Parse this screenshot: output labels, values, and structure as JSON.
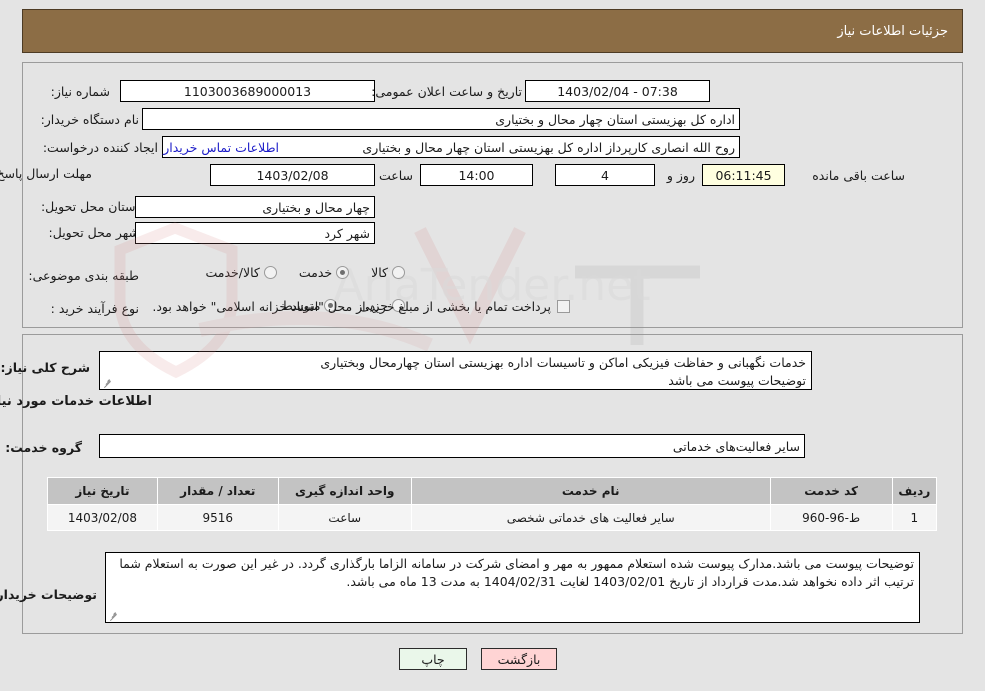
{
  "header": {
    "title": "جزئیات اطلاعات نیاز"
  },
  "top_form": {
    "need_number_label": "شماره نیاز:",
    "need_number_value": "1103003689000013",
    "public_announce_label": "تاریخ و ساعت اعلان عمومی:",
    "public_announce_value": "07:38 - 1403/02/04",
    "buyer_org_label": "نام دستگاه خریدار:",
    "buyer_org_value": "اداره کل بهزیستی استان چهار محال و بختیاری",
    "requester_label": "ایجاد کننده درخواست:",
    "requester_value": "روح الله انصاری کارپرداز اداره کل بهزیستی استان چهار محال و بختیاری",
    "buyer_contact_link": "اطلاعات تماس خریدار",
    "deadline_label": "مهلت ارسال پاسخ: تا تاریخ:",
    "deadline_date": "1403/02/08",
    "deadline_hour_label": "ساعت",
    "deadline_hour_value": "14:00",
    "remaining_days_value": "4",
    "remaining_days_label": "روز و",
    "remaining_time_value": "06:11:45",
    "remaining_time_label": "ساعت باقی مانده",
    "province_label": "استان محل تحویل:",
    "province_value": "چهار محال و بختیاری",
    "city_label": "شهر محل تحویل:",
    "city_value": "شهر کرد",
    "category_label": "طبقه بندی موضوعی:",
    "category_options": [
      {
        "label": "کالا",
        "selected": false
      },
      {
        "label": "خدمت",
        "selected": true
      },
      {
        "label": "کالا/خدمت",
        "selected": false
      }
    ],
    "process_label": "نوع فرآیند خرید :",
    "process_options": [
      {
        "label": "جزیی",
        "selected": false
      },
      {
        "label": "متوسط",
        "selected": true
      }
    ],
    "treasury_checkbox_label": "پرداخت تمام یا بخشی از مبلغ خرید،از محل \"اسناد خزانه اسلامی\" خواهد بود.",
    "treasury_checkbox_checked": false
  },
  "middle": {
    "general_desc_label": "شرح کلی نیاز:",
    "general_desc_value": "خدمات نگهبانی و حفاظت فیزیکی اماکن و تاسیسات اداره بهزیستی استان چهارمحال وبختیاری\nتوضیحات پیوست می باشد",
    "services_section_title": "اطلاعات خدمات مورد نیاز",
    "service_group_label": "گروه خدمت:",
    "service_group_value": "سایر فعالیت‌های خدماتی",
    "table": {
      "columns": [
        "ردیف",
        "کد خدمت",
        "نام خدمت",
        "واحد اندازه گیری",
        "تعداد / مقدار",
        "تاریخ نیاز"
      ],
      "rows": [
        {
          "row_no": "1",
          "service_code": "ط-96-960",
          "service_name": "سایر فعالیت های خدماتی شخصی",
          "unit": "ساعت",
          "quantity": "9516",
          "need_date": "1403/02/08"
        }
      ]
    },
    "buyer_notes_label": "توضیحات خریدار:",
    "buyer_notes_value": "توضیحات پیوست می باشد.مدارک پیوست شده استعلام ممهور به مهر و امضای شرکت در سامانه الزاما بارگذاری گردد. در غیر این صورت به استعلام شما ترتیب اثر داده نخواهد شد.مدت قرارداد از تاریخ 1403/02/01 لغایت 1404/02/31 به مدت 13 ماه می باشد."
  },
  "footer": {
    "print_label": "چاپ",
    "back_label": "بازگشت"
  },
  "colors": {
    "header_bg": "#8c6d45",
    "panel_bg": "#e4e4e4",
    "link": "#1c1cc8",
    "timer_bg": "#ffffe0",
    "table_header_bg": "#c3c3c3",
    "print_btn_bg": "#eaf7ea",
    "back_btn_bg": "#ffd4d4"
  },
  "watermark": {
    "text": "AriaTender.net"
  }
}
